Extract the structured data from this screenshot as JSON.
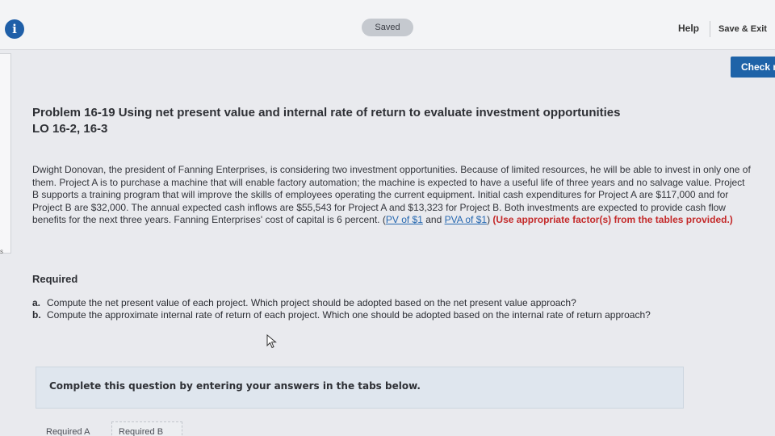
{
  "header": {
    "info_icon_glyph": "i",
    "saved_label": "Saved",
    "help_label": "Help",
    "save_exit_label": "Save & Exit",
    "check_label": "Check my work"
  },
  "problem": {
    "title_line1": "Problem 16-19 Using net present value and internal rate of return to evaluate investment opportunities",
    "title_line2": "LO 16-2, 16-3",
    "intro_text": "Dwight Donovan, the president of Fanning Enterprises, is considering two investment opportunities. Because of limited resources, he will be able to invest in only one of them. Project A is to purchase a machine that will enable factory automation; the machine is expected to have a useful life of three years and no salvage value. Project B supports a training program that will improve the skills of employees operating the current equipment. Initial cash expenditures for Project A are $117,000 and for Project B are $32,000. The annual expected cash inflows are $55,543 for Project A and $13,323 for Project B. Both investments are expected to provide cash flow benefits for the next three years. Fanning Enterprises' cost of capital is 6 percent. (",
    "link_pv": "PV of $1",
    "link_and": " and ",
    "link_pva": "PVA of $1",
    "close_paren": ") ",
    "red_note": "(Use appropriate factor(s) from the tables provided.)"
  },
  "required": {
    "heading": "Required",
    "items": [
      {
        "letter": "a.",
        "text": "Compute the net present value of each project. Which project should be adopted based on the net present value approach?"
      },
      {
        "letter": "b.",
        "text": "Compute the approximate internal rate of return of each project. Which one should be adopted based on the internal rate of return approach?"
      }
    ]
  },
  "answer_panel": {
    "instruction": "Complete this question by entering your answers in the tabs below."
  },
  "tabs": [
    {
      "label": "Required A"
    },
    {
      "label": "Required B"
    }
  ],
  "colors": {
    "accent_blue": "#1e63a8",
    "link_blue": "#2668b0",
    "note_red": "#c42a2a"
  }
}
